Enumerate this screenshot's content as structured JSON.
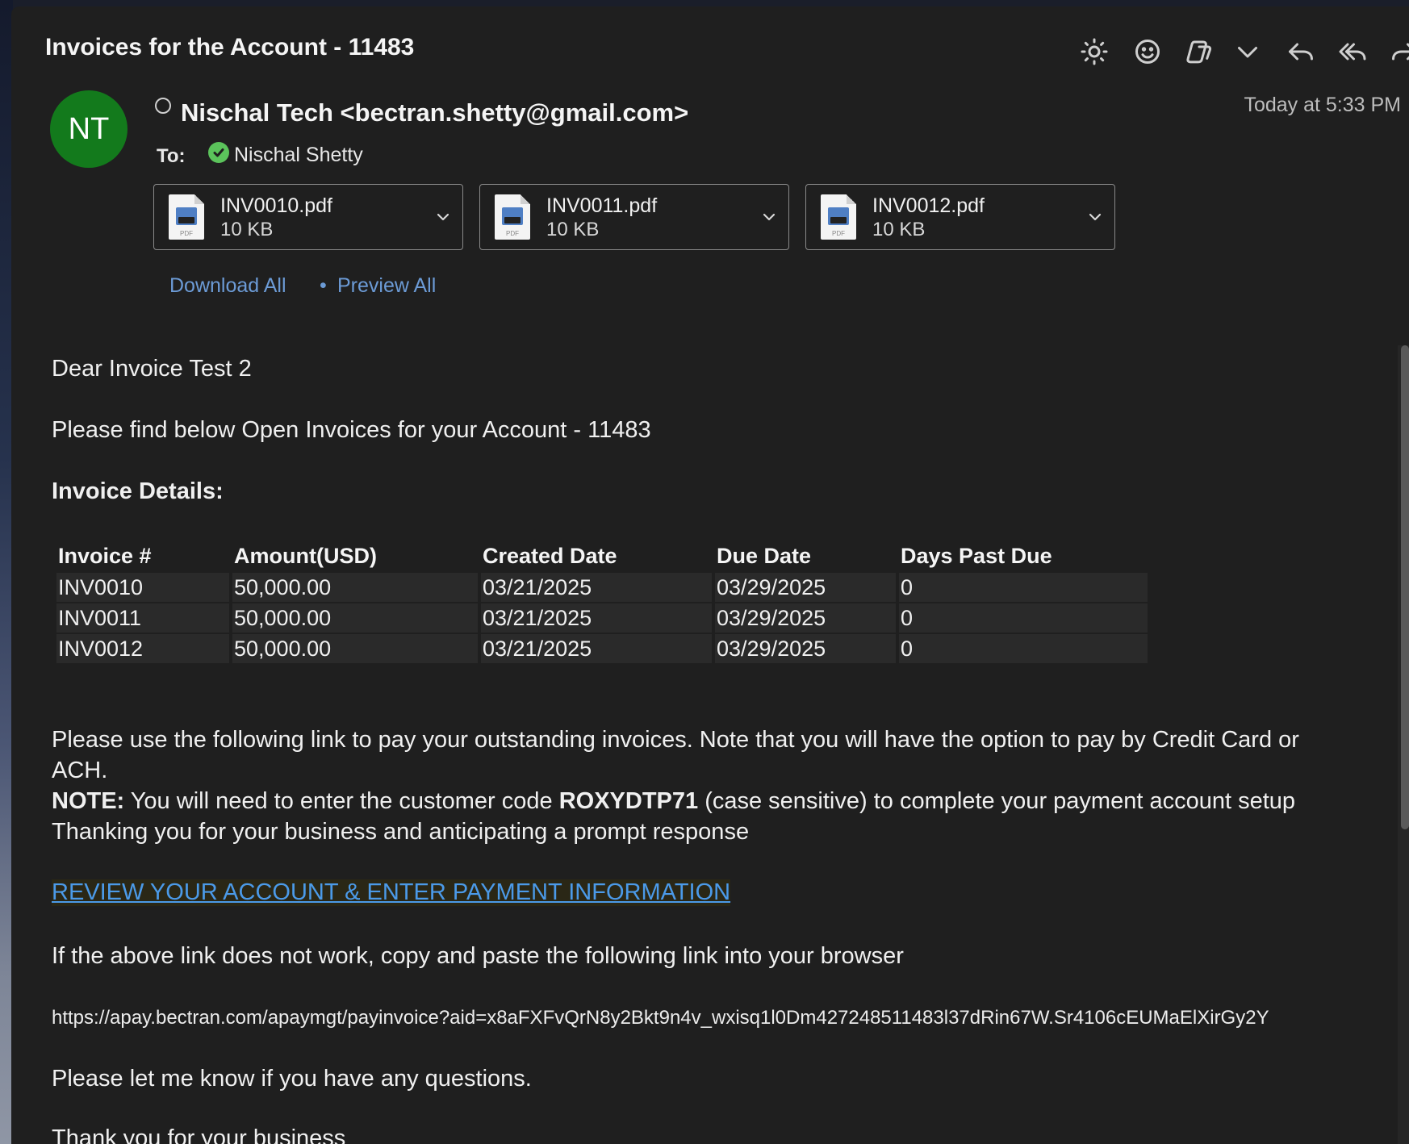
{
  "message": {
    "subject": "Invoices for the Account - 11483",
    "avatar_initials": "NT",
    "sender": "Nischal Tech <bectran.shetty@gmail.com>",
    "timestamp": "Today at 5:33 PM",
    "to_label": "To:",
    "recipient": "Nischal Shetty"
  },
  "toolbar": {
    "icons": [
      "brightness-icon",
      "emoji-icon",
      "copilot-icon",
      "chevron-down-icon",
      "reply-icon",
      "reply-all-icon",
      "forward-icon"
    ]
  },
  "attachments": [
    {
      "name": "INV0010.pdf",
      "size": "10 KB"
    },
    {
      "name": "INV0011.pdf",
      "size": "10 KB"
    },
    {
      "name": "INV0012.pdf",
      "size": "10 KB"
    }
  ],
  "attachment_icon_label": "PDF",
  "attachment_actions": {
    "download_all": "Download All",
    "separator": "•",
    "preview_all": "Preview All"
  },
  "body": {
    "greeting": "Dear Invoice Test 2",
    "intro": "Please find below Open Invoices for your Account - 11483",
    "details_heading": "Invoice Details:",
    "table": {
      "headers": [
        "Invoice #",
        "Amount(USD)",
        "Created Date",
        "Due Date",
        "Days Past Due"
      ],
      "rows": [
        [
          "INV0010",
          "50,000.00",
          "03/21/2025",
          "03/29/2025",
          "0"
        ],
        [
          "INV0011",
          "50,000.00",
          "03/21/2025",
          "03/29/2025",
          "0"
        ],
        [
          "INV0012",
          "50,000.00",
          "03/21/2025",
          "03/29/2025",
          "0"
        ]
      ]
    },
    "pay_line_1": "Please use the following link to pay your outstanding invoices. Note that you will have the option to pay by Credit Card or",
    "pay_line_2": "ACH.",
    "note_label": "NOTE:",
    "note_pre": " You will need to enter the customer code ",
    "customer_code": "ROXYDTP71",
    "note_post": " (case sensitive) to complete your payment account setup",
    "thanks_line": "Thanking you for your business and anticipating a prompt response",
    "payment_link": "REVIEW YOUR ACCOUNT & ENTER PAYMENT INFORMATION",
    "fallback_text": "If the above link does not work, copy and paste the following link into your browser",
    "url": "https://apay.bectran.com/apaymgt/payinvoice?aid=x8aFXFvQrN8y2Bkt9n4v_wxisq1l0Dm427248511483l37dRin67W.Sr4106cEUMaElXirGy2Y",
    "questions": "Please let me know if you have any questions.",
    "signoff": "Thank you for your business"
  }
}
